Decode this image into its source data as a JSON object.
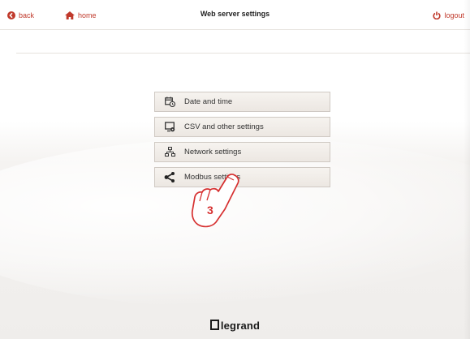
{
  "header": {
    "back_label": "back",
    "home_label": "home",
    "title": "Web server settings",
    "logout_label": "logout",
    "accent_color": "#c0392b"
  },
  "menu": {
    "items": [
      {
        "label": "Date and time",
        "icon": "calendar-clock-icon"
      },
      {
        "label": "CSV and other settings",
        "icon": "monitor-settings-icon"
      },
      {
        "label": "Network settings",
        "icon": "network-tree-icon"
      },
      {
        "label": "Modbus settings",
        "icon": "share-nodes-icon"
      }
    ]
  },
  "annotation": {
    "step_number": "3",
    "icon": "pointing-hand-icon"
  },
  "footer": {
    "brand": "legrand"
  }
}
